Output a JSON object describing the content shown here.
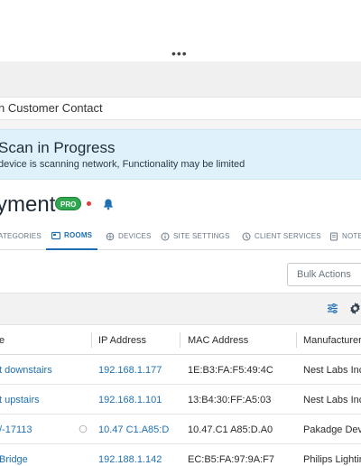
{
  "header": {
    "more_menu": "•••"
  },
  "contact_bar": {
    "text": "n Customer Contact"
  },
  "banner": {
    "title": "Scan in Progress",
    "subtitle": "device is scanning network, Functionality may be limited"
  },
  "page": {
    "title": "yment",
    "badge": "PRO"
  },
  "tabs": [
    {
      "label": "ATEGORIES",
      "icon": "categories-icon"
    },
    {
      "label": "ROOMS",
      "icon": "rooms-icon",
      "active": true
    },
    {
      "label": "DEVICES",
      "icon": "devices-icon"
    },
    {
      "label": "SITE SETTINGS",
      "icon": "info-icon"
    },
    {
      "label": "CLIENT SERVICES",
      "icon": "client-services-icon"
    },
    {
      "label": "NOTE",
      "icon": "notes-icon"
    }
  ],
  "actions": {
    "bulk_actions": "Bulk Actions"
  },
  "table": {
    "columns": [
      "e",
      "IP Address",
      "MAC Address",
      "Manufacturer"
    ],
    "rows": [
      {
        "name": "t downstairs",
        "ip": "192.168.1.177",
        "mac": "1E:B3:FA:F5:49:4C",
        "manufacturer": "Nest Labs Inc"
      },
      {
        "name": "t upstairs",
        "ip": "192.168.1.101",
        "mac": "13:B4:30:FF:A5:03",
        "manufacturer": "Nest Labs Inc"
      },
      {
        "name": "/-17113",
        "ip": "10.47 C1.A85:D",
        "mac": "10.47.C1 A85:D.A0",
        "manufacturer": "Pakadge Dev"
      },
      {
        "name": "Bridge",
        "ip": "192.188.1.142",
        "mac": "EC:B5:FA:97:9A:F7",
        "manufacturer": "Philips Lightin"
      }
    ]
  },
  "colors": {
    "accent": "#1f6fb2",
    "banner_bg": "#dff2fb",
    "badge": "#2fa84f",
    "alert_dot": "#e23b3b"
  }
}
